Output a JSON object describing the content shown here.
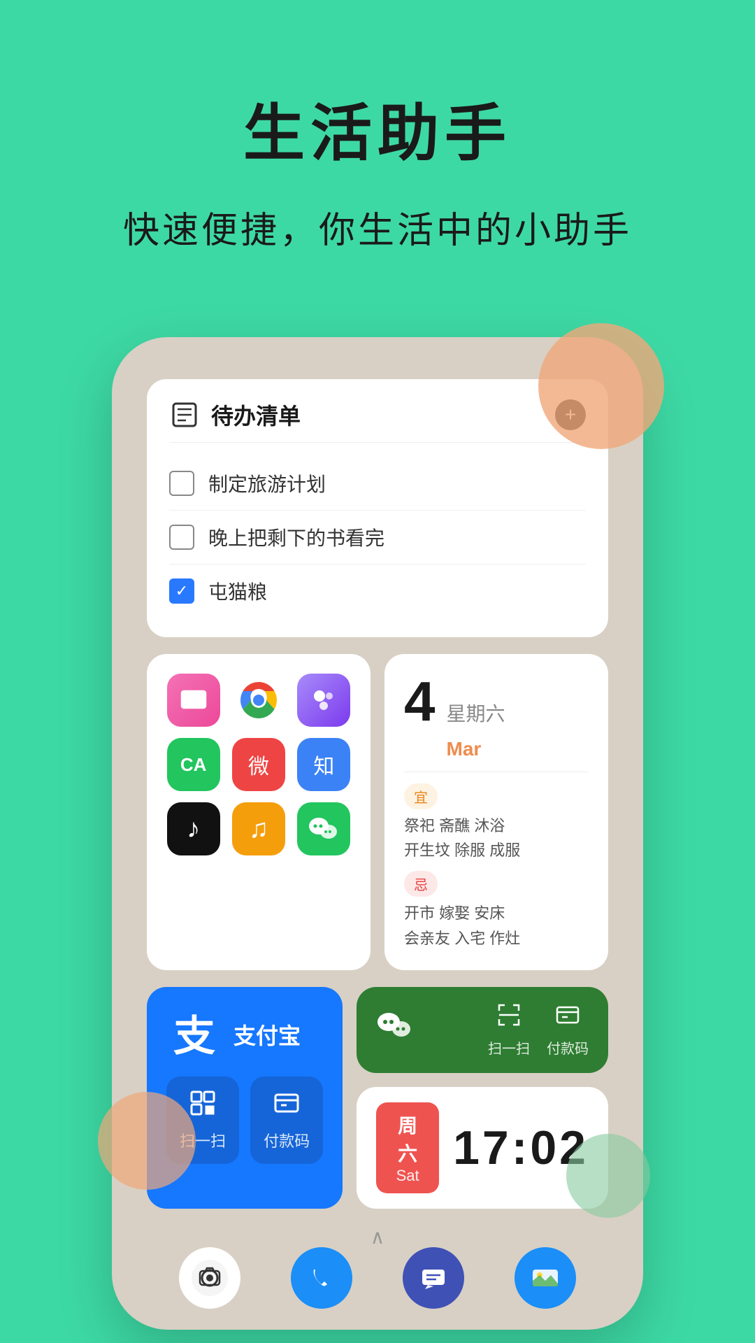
{
  "page": {
    "background_color": "#3DD9A4",
    "title": "生活助手",
    "subtitle": "快速便捷，你生活中的小助手"
  },
  "todo_widget": {
    "title": "待办清单",
    "add_button_label": "+",
    "items": [
      {
        "text": "制定旅游计划",
        "checked": false
      },
      {
        "text": "晚上把剩下的书看完",
        "checked": false
      },
      {
        "text": "屯猫粮",
        "checked": true
      }
    ]
  },
  "app_grid": {
    "apps": [
      {
        "name": "TV/Media",
        "color": "pink",
        "icon": "📺"
      },
      {
        "name": "Chrome",
        "color": "chrome",
        "icon": "⊕"
      },
      {
        "name": "Blue App",
        "color": "blue-app",
        "icon": "⬡"
      },
      {
        "name": "CA",
        "color": "green-ca",
        "icon": "CA"
      },
      {
        "name": "Weibo",
        "color": "weibo",
        "icon": "微"
      },
      {
        "name": "Zhihu",
        "color": "zhihu",
        "icon": "知"
      },
      {
        "name": "TikTok",
        "color": "tiktok",
        "icon": "♪"
      },
      {
        "name": "Music",
        "color": "music",
        "icon": "♫"
      },
      {
        "name": "WeChat",
        "color": "wechat-green",
        "icon": "💬"
      }
    ]
  },
  "calendar_widget": {
    "date_number": "4",
    "weekday": "星期六",
    "month": "Mar",
    "good_label": "宜",
    "good_activities": "祭祀 斋醮 沐浴\n开生坟 除服 成服",
    "bad_label": "忌",
    "bad_activities": "开市 嫁娶 安床\n会亲友 入宅 作灶"
  },
  "alipay_widget": {
    "name": "支付宝",
    "logo_char": "支",
    "scan_label": "扫一扫",
    "pay_label": "付款码",
    "scan_icon": "⊡",
    "pay_icon": "⊞"
  },
  "wechat_actions_widget": {
    "scan_label": "扫一扫",
    "pay_label": "付款码"
  },
  "clock_widget": {
    "day_zh": "周六",
    "day_en": "Sat",
    "time": "17:02"
  },
  "dock": {
    "icons": [
      {
        "name": "camera",
        "emoji": "📷"
      },
      {
        "name": "phone",
        "emoji": "📞"
      },
      {
        "name": "message",
        "emoji": "💬"
      },
      {
        "name": "gallery",
        "emoji": "🖼"
      }
    ]
  }
}
